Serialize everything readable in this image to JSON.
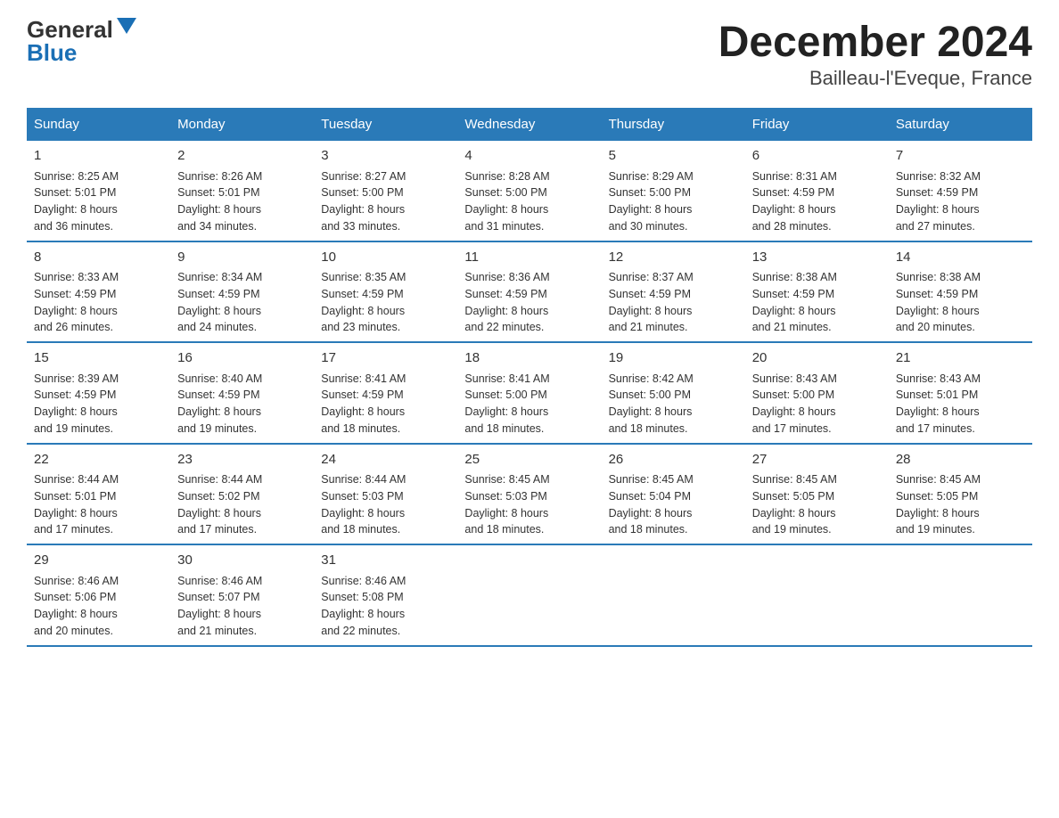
{
  "header": {
    "logo_general": "General",
    "logo_blue": "Blue",
    "month_title": "December 2024",
    "location": "Bailleau-l'Eveque, France"
  },
  "days_of_week": [
    "Sunday",
    "Monday",
    "Tuesday",
    "Wednesday",
    "Thursday",
    "Friday",
    "Saturday"
  ],
  "weeks": [
    [
      {
        "day": "1",
        "sunrise": "8:25 AM",
        "sunset": "5:01 PM",
        "daylight": "8 hours and 36 minutes."
      },
      {
        "day": "2",
        "sunrise": "8:26 AM",
        "sunset": "5:01 PM",
        "daylight": "8 hours and 34 minutes."
      },
      {
        "day": "3",
        "sunrise": "8:27 AM",
        "sunset": "5:00 PM",
        "daylight": "8 hours and 33 minutes."
      },
      {
        "day": "4",
        "sunrise": "8:28 AM",
        "sunset": "5:00 PM",
        "daylight": "8 hours and 31 minutes."
      },
      {
        "day": "5",
        "sunrise": "8:29 AM",
        "sunset": "5:00 PM",
        "daylight": "8 hours and 30 minutes."
      },
      {
        "day": "6",
        "sunrise": "8:31 AM",
        "sunset": "4:59 PM",
        "daylight": "8 hours and 28 minutes."
      },
      {
        "day": "7",
        "sunrise": "8:32 AM",
        "sunset": "4:59 PM",
        "daylight": "8 hours and 27 minutes."
      }
    ],
    [
      {
        "day": "8",
        "sunrise": "8:33 AM",
        "sunset": "4:59 PM",
        "daylight": "8 hours and 26 minutes."
      },
      {
        "day": "9",
        "sunrise": "8:34 AM",
        "sunset": "4:59 PM",
        "daylight": "8 hours and 24 minutes."
      },
      {
        "day": "10",
        "sunrise": "8:35 AM",
        "sunset": "4:59 PM",
        "daylight": "8 hours and 23 minutes."
      },
      {
        "day": "11",
        "sunrise": "8:36 AM",
        "sunset": "4:59 PM",
        "daylight": "8 hours and 22 minutes."
      },
      {
        "day": "12",
        "sunrise": "8:37 AM",
        "sunset": "4:59 PM",
        "daylight": "8 hours and 21 minutes."
      },
      {
        "day": "13",
        "sunrise": "8:38 AM",
        "sunset": "4:59 PM",
        "daylight": "8 hours and 21 minutes."
      },
      {
        "day": "14",
        "sunrise": "8:38 AM",
        "sunset": "4:59 PM",
        "daylight": "8 hours and 20 minutes."
      }
    ],
    [
      {
        "day": "15",
        "sunrise": "8:39 AM",
        "sunset": "4:59 PM",
        "daylight": "8 hours and 19 minutes."
      },
      {
        "day": "16",
        "sunrise": "8:40 AM",
        "sunset": "4:59 PM",
        "daylight": "8 hours and 19 minutes."
      },
      {
        "day": "17",
        "sunrise": "8:41 AM",
        "sunset": "4:59 PM",
        "daylight": "8 hours and 18 minutes."
      },
      {
        "day": "18",
        "sunrise": "8:41 AM",
        "sunset": "5:00 PM",
        "daylight": "8 hours and 18 minutes."
      },
      {
        "day": "19",
        "sunrise": "8:42 AM",
        "sunset": "5:00 PM",
        "daylight": "8 hours and 18 minutes."
      },
      {
        "day": "20",
        "sunrise": "8:43 AM",
        "sunset": "5:00 PM",
        "daylight": "8 hours and 17 minutes."
      },
      {
        "day": "21",
        "sunrise": "8:43 AM",
        "sunset": "5:01 PM",
        "daylight": "8 hours and 17 minutes."
      }
    ],
    [
      {
        "day": "22",
        "sunrise": "8:44 AM",
        "sunset": "5:01 PM",
        "daylight": "8 hours and 17 minutes."
      },
      {
        "day": "23",
        "sunrise": "8:44 AM",
        "sunset": "5:02 PM",
        "daylight": "8 hours and 17 minutes."
      },
      {
        "day": "24",
        "sunrise": "8:44 AM",
        "sunset": "5:03 PM",
        "daylight": "8 hours and 18 minutes."
      },
      {
        "day": "25",
        "sunrise": "8:45 AM",
        "sunset": "5:03 PM",
        "daylight": "8 hours and 18 minutes."
      },
      {
        "day": "26",
        "sunrise": "8:45 AM",
        "sunset": "5:04 PM",
        "daylight": "8 hours and 18 minutes."
      },
      {
        "day": "27",
        "sunrise": "8:45 AM",
        "sunset": "5:05 PM",
        "daylight": "8 hours and 19 minutes."
      },
      {
        "day": "28",
        "sunrise": "8:45 AM",
        "sunset": "5:05 PM",
        "daylight": "8 hours and 19 minutes."
      }
    ],
    [
      {
        "day": "29",
        "sunrise": "8:46 AM",
        "sunset": "5:06 PM",
        "daylight": "8 hours and 20 minutes."
      },
      {
        "day": "30",
        "sunrise": "8:46 AM",
        "sunset": "5:07 PM",
        "daylight": "8 hours and 21 minutes."
      },
      {
        "day": "31",
        "sunrise": "8:46 AM",
        "sunset": "5:08 PM",
        "daylight": "8 hours and 22 minutes."
      },
      {
        "day": "",
        "sunrise": "",
        "sunset": "",
        "daylight": ""
      },
      {
        "day": "",
        "sunrise": "",
        "sunset": "",
        "daylight": ""
      },
      {
        "day": "",
        "sunrise": "",
        "sunset": "",
        "daylight": ""
      },
      {
        "day": "",
        "sunrise": "",
        "sunset": "",
        "daylight": ""
      }
    ]
  ],
  "labels": {
    "sunrise": "Sunrise:",
    "sunset": "Sunset:",
    "daylight": "Daylight:"
  }
}
